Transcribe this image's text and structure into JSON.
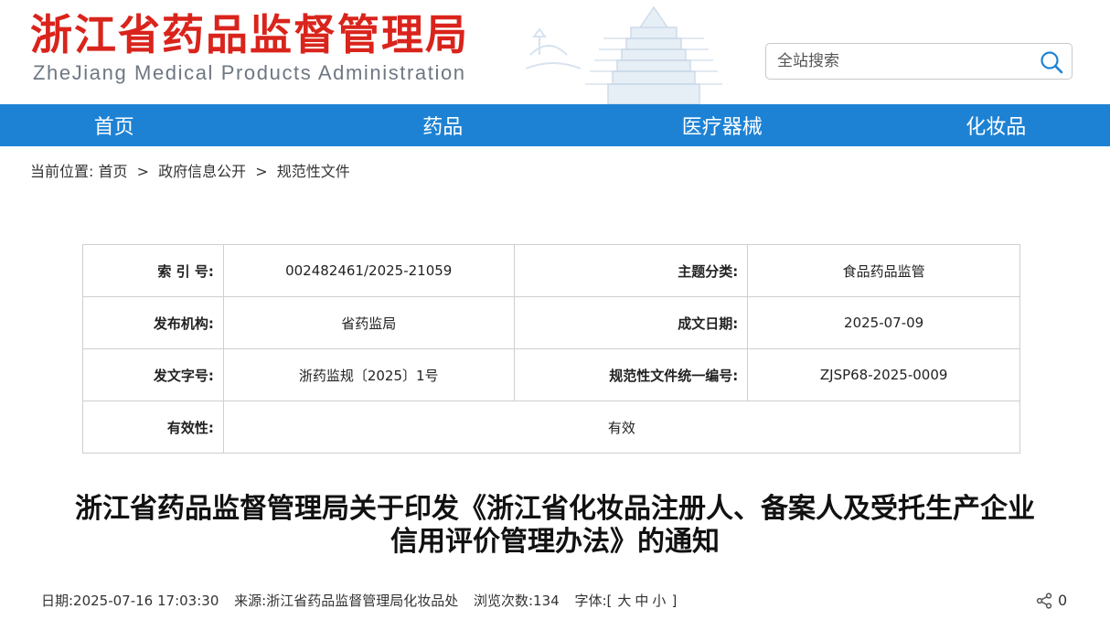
{
  "header": {
    "title": "浙江省药品监督管理局",
    "subtitle": "ZheJiang Medical Products Administration",
    "search_placeholder": "全站搜索"
  },
  "nav": {
    "items": [
      "首页",
      "药品",
      "医疗器械",
      "化妆品"
    ]
  },
  "breadcrumb": {
    "prefix": "当前位置:",
    "items": [
      "首页",
      "政府信息公开",
      "规范性文件"
    ],
    "separator": ">"
  },
  "info": {
    "index_label": "索 引 号:",
    "index_value": "002482461/2025-21059",
    "topic_label": "主题分类:",
    "topic_value": "食品药品监管",
    "issuer_label": "发布机构:",
    "issuer_value": "省药监局",
    "date_label": "成文日期:",
    "date_value": "2025-07-09",
    "docno_label": "发文字号:",
    "docno_value": "浙药监规〔2025〕1号",
    "code_label": "规范性文件统一编号:",
    "code_value": "ZJSP68-2025-0009",
    "validity_label": "有效性:",
    "validity_value": "有效"
  },
  "article": {
    "title_line1": "浙江省药品监督管理局关于印发《浙江省化妆品注册人、备案人及受托生产企业",
    "title_line2": "信用评价管理办法》的通知"
  },
  "meta": {
    "date": "日期:2025-07-16 17:03:30",
    "source": "来源:浙江省药品监督管理局化妆品处",
    "views": "浏览次数:134",
    "font_label": "字体:",
    "font_open": "[",
    "font_large": "大",
    "font_medium": "中",
    "font_small": "小",
    "font_close": "]",
    "share_count": "0"
  },
  "colors": {
    "brand_red": "#d9241c",
    "nav_blue": "#1e82d4"
  }
}
